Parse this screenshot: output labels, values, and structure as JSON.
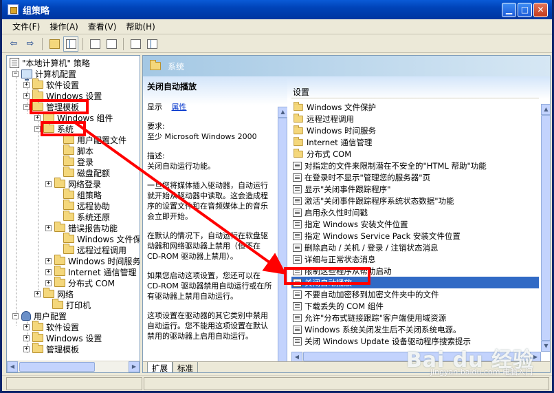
{
  "window": {
    "title": "组策略"
  },
  "menu": [
    "文件(F)",
    "操作(A)",
    "查看(V)",
    "帮助(H)"
  ],
  "tree": {
    "root": "\"本地计算机\" 策略",
    "computer_config": "计算机配置",
    "software_settings": "软件设置",
    "windows_settings": "Windows 设置",
    "admin_templates": "管理模板",
    "windows_components": "Windows 组件",
    "system": "系统",
    "system_children": [
      "用户配置文件",
      "脚本",
      "登录",
      "磁盘配额",
      "网络登录",
      "组策略",
      "远程协助",
      "系统还原",
      "错误报告功能",
      "Windows 文件保护",
      "远程过程调用",
      "Windows 时间服务",
      "Internet 通信管理",
      "分布式 COM"
    ],
    "network": "网络",
    "printers": "打印机",
    "user_config": "用户配置",
    "user_software_settings": "软件设置",
    "user_windows_settings": "Windows 设置",
    "user_admin_templates": "管理模板"
  },
  "header": {
    "label": "系统"
  },
  "description": {
    "title": "关闭自动播放",
    "show_label": "显示",
    "properties_link": "属性",
    "requirements_label": "要求:",
    "requirements_value": "至少 Microsoft Windows 2000",
    "desc_label": "描述:",
    "desc_line": "关闭自动运行功能。",
    "para1": "一旦您将媒体插入驱动器，自动运行就开始从驱动器中读取。这会造成程序的设置文件和在音频媒体上的音乐会立即开始。",
    "para2": "在默认的情况下，自动运行在软盘驱动器和网络驱动器上禁用（但不在 CD-ROM 驱动器上禁用）。",
    "para3": "如果您启动这项设置，您还可以在 CD-ROM 驱动器禁用自动运行或在所有驱动器上禁用自动运行。",
    "para4": "这项设置在驱动器的其它类别中禁用自动运行。您不能用这项设置在默认禁用的驱动器上启用自动运行。"
  },
  "list": {
    "header": "设置",
    "folders": [
      "Windows 文件保护",
      "远程过程调用",
      "Windows 时间服务",
      "Internet 通信管理",
      "分布式 COM"
    ],
    "settings": [
      "对指定的文件来限制潜在不安全的\"HTML 帮助\"功能",
      "在登录时不显示\"管理您的服务器\"页",
      "显示\"关闭事件跟踪程序\"",
      "激活\"关闭事件跟踪程序系统状态数据\"功能",
      "启用永久性时间戳",
      "指定 Windows 安装文件位置",
      "指定 Windows Service Pack 安装文件位置",
      "删除启动 / 关机 / 登录 / 注销状态消息",
      "详细与正常状态消息",
      "限制这些程序从帮助启动",
      "关闭自动播放",
      "不要自动加密移到加密文件夹中的文件",
      "下载丢失的 COM 组件",
      "允许\"分布式链接跟踪\"客户端使用域资源",
      "Windows 系统关闭发生后不关闭系统电源。",
      "关闭 Windows Update 设备驱动程序搜索提示"
    ],
    "selected_index": 10
  },
  "tabs": [
    "扩展",
    "标准"
  ],
  "watermark": {
    "brand": "Bai du 经验",
    "url": "jingyan.baidu.com",
    "tag": "电脑入门"
  },
  "colors": {
    "annotation": "#ff0000",
    "selection": "#316ac5",
    "title_bar": "#0043b8"
  }
}
